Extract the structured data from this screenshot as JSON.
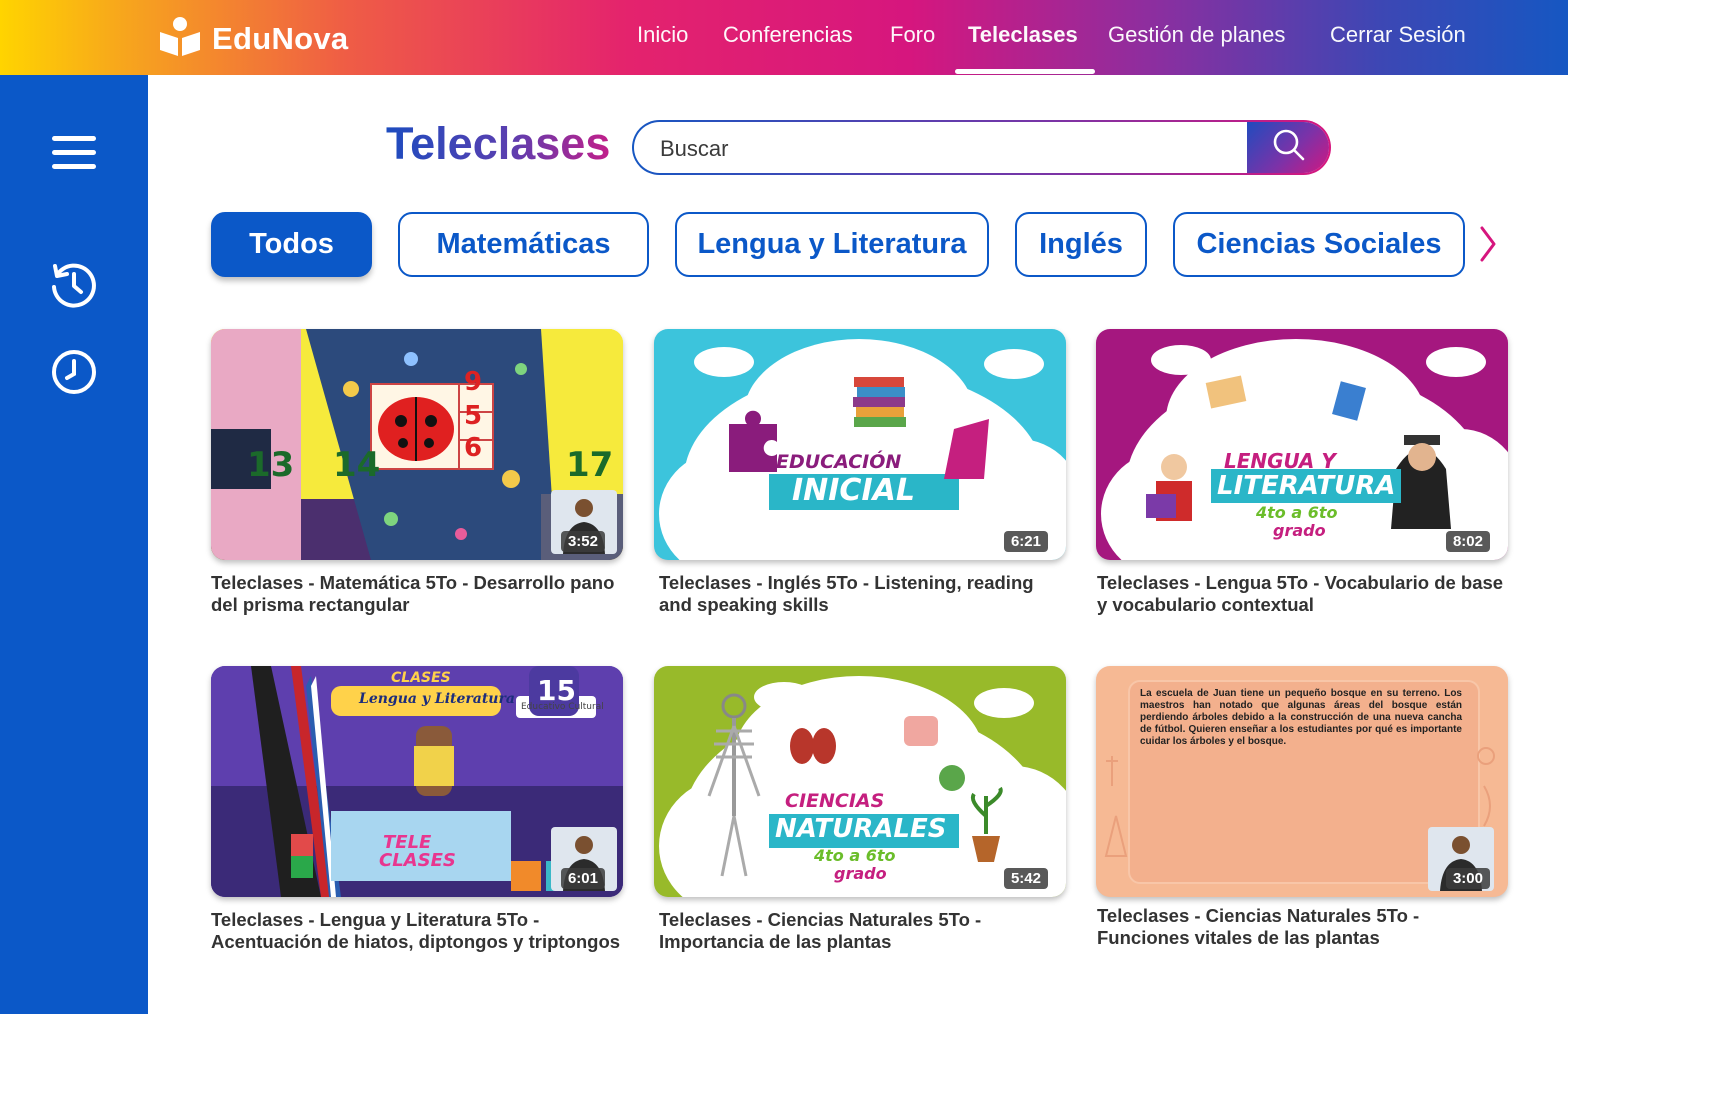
{
  "app": {
    "name": "EduNova"
  },
  "nav": {
    "items": [
      {
        "label": "Inicio"
      },
      {
        "label": "Conferencias"
      },
      {
        "label": "Foro"
      },
      {
        "label": "Teleclases"
      },
      {
        "label": "Gestión de planes"
      },
      {
        "label": "Cerrar Sesión"
      }
    ],
    "active": "Teleclases"
  },
  "sidebar": {
    "icons": [
      "menu-icon",
      "history-icon",
      "clock-icon"
    ]
  },
  "page": {
    "title": "Teleclases"
  },
  "search": {
    "placeholder": "Buscar",
    "icon": "search-icon"
  },
  "filters": {
    "chips": [
      {
        "label": "Todos",
        "active": true
      },
      {
        "label": "Matemáticas"
      },
      {
        "label": "Lengua y Literatura"
      },
      {
        "label": "Inglés"
      },
      {
        "label": "Ciencias Sociales"
      }
    ],
    "next_icon": "chevron-right-icon"
  },
  "colors": {
    "primary": "#0b58c8",
    "accent_pink": "#d6167e",
    "text": "#333333"
  },
  "videos": [
    {
      "title": "Teleclases - Matemática 5To - Desarrollo pano del prisma rectangular",
      "duration": "3:52",
      "thumb": {
        "numbers": [
          "9",
          "5",
          "6",
          "13",
          "14",
          "17"
        ]
      }
    },
    {
      "title": "Teleclases - Inglés 5To - Listening, reading and speaking skills",
      "duration": "6:21",
      "thumb": {
        "line1": "EDUCACIÓN",
        "line2": "INICIAL"
      }
    },
    {
      "title": "Teleclases - Lengua 5To - Vocabulario de base y vocabulario contextual",
      "duration": "8:02",
      "thumb": {
        "line1": "LENGUA Y",
        "line2": "LITERATURA",
        "line3": "4to a 6to",
        "line4": "grado"
      }
    },
    {
      "title": "Teleclases - Lengua y Literatura 5To - Acentuación de hiatos, diptongos y triptongos",
      "duration": "6:01",
      "thumb": {
        "line1": "TELE",
        "line2": "CLASES",
        "banner": "Lengua y Literatura",
        "corner": "CLASES",
        "badge": "15",
        "sign": "Educativo Cultural"
      }
    },
    {
      "title": "Teleclases - Ciencias Naturales  5To - Importancia de las plantas",
      "duration": "5:42",
      "thumb": {
        "line1": "CIENCIAS",
        "line2": "NATURALES",
        "line3": "4to a 6to",
        "line4": "grado"
      }
    },
    {
      "title": "Teleclases - Ciencias Naturales  5To - Funciones vitales de las plantas",
      "duration": "3:00",
      "thumb": {
        "text": "La escuela de Juan tiene un pequeño bosque en su terreno. Los maestros han notado que algunas áreas del bosque están perdiendo árboles debido a la construcción de una nueva cancha de fútbol. Quieren enseñar a los estudiantes por qué es importante cuidar los árboles y el bosque."
      }
    }
  ]
}
